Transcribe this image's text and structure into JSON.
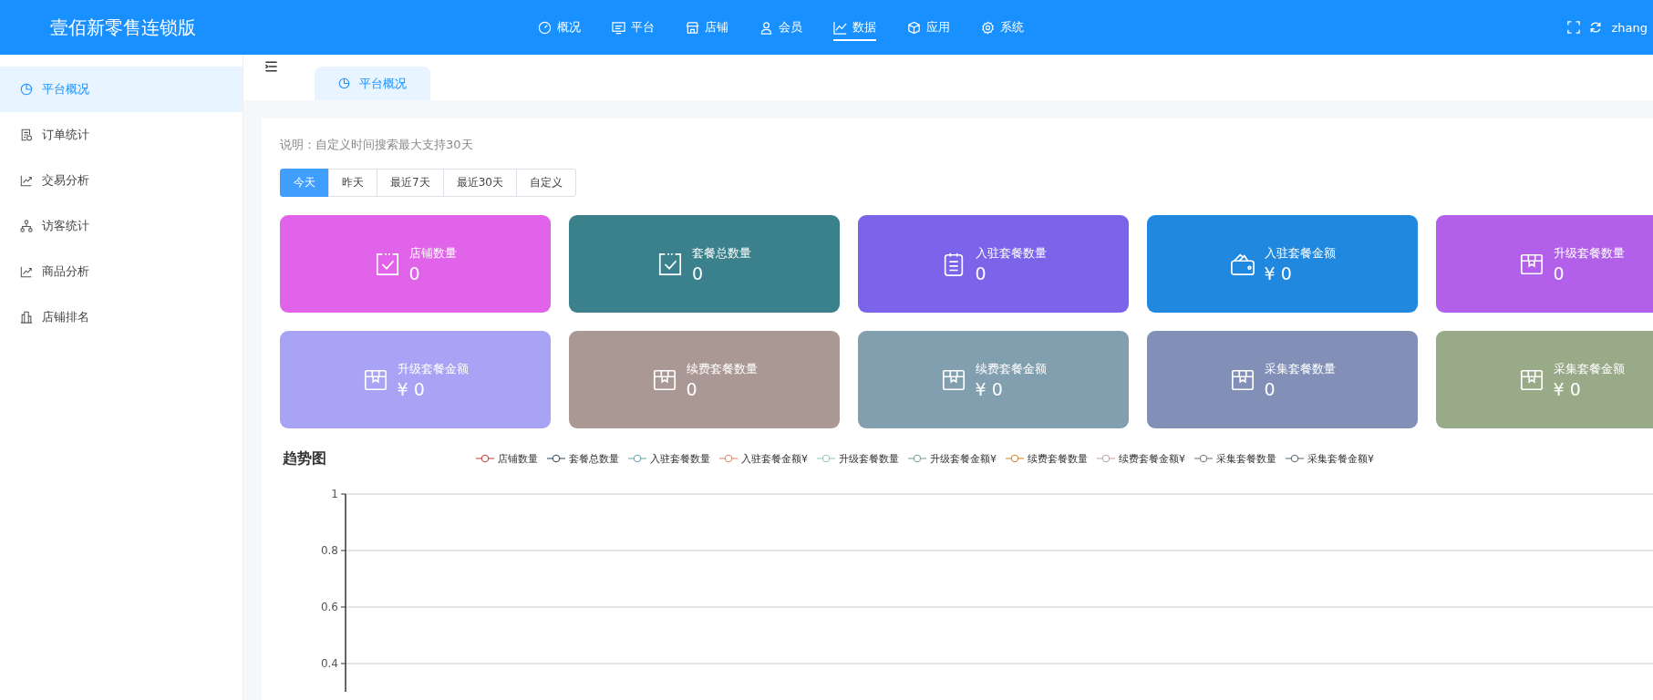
{
  "header": {
    "brand": "壹佰新零售连锁版",
    "nav": [
      {
        "label": "概况",
        "selected": false
      },
      {
        "label": "平台",
        "selected": false
      },
      {
        "label": "店铺",
        "selected": false
      },
      {
        "label": "会员",
        "selected": false
      },
      {
        "label": "数据",
        "selected": true
      },
      {
        "label": "应用",
        "selected": false
      },
      {
        "label": "系统",
        "selected": false
      }
    ],
    "user": "zhang"
  },
  "sidebar": {
    "items": [
      {
        "label": "平台概况",
        "selected": true
      },
      {
        "label": "订单统计",
        "selected": false
      },
      {
        "label": "交易分析",
        "selected": false
      },
      {
        "label": "访客统计",
        "selected": false
      },
      {
        "label": "商品分析",
        "selected": false
      },
      {
        "label": "店铺排名",
        "selected": false
      }
    ]
  },
  "tabs": [
    {
      "label": "平台概况",
      "selected": true
    }
  ],
  "note": "说明：自定义时间搜索最大支持30天",
  "ranges": [
    {
      "label": "今天",
      "selected": true
    },
    {
      "label": "昨天",
      "selected": false
    },
    {
      "label": "最近7天",
      "selected": false
    },
    {
      "label": "最近30天",
      "selected": false
    },
    {
      "label": "自定义",
      "selected": false
    }
  ],
  "cards": [
    {
      "kind": "check",
      "label": "店铺数量",
      "value": "0",
      "color": "#e063ea"
    },
    {
      "kind": "check",
      "label": "套餐总数量",
      "value": "0",
      "color": "#3a818c"
    },
    {
      "kind": "clipboard",
      "label": "入驻套餐数量",
      "value": "0",
      "color": "#7b63ea"
    },
    {
      "kind": "wallet",
      "label": "入驻套餐金额",
      "value": "¥ 0",
      "color": "#2188e0"
    },
    {
      "kind": "box",
      "label": "升级套餐数量",
      "value": "0",
      "color": "#b260ea"
    },
    {
      "kind": "box",
      "label": "升级套餐金额",
      "value": "¥ 0",
      "color": "#a9a3f5"
    },
    {
      "kind": "box",
      "label": "续费套餐数量",
      "value": "0",
      "color": "#aa9895"
    },
    {
      "kind": "box",
      "label": "续费套餐金额",
      "value": "¥ 0",
      "color": "#829fb0"
    },
    {
      "kind": "box",
      "label": "采集套餐数量",
      "value": "0",
      "color": "#8290b8"
    },
    {
      "kind": "box",
      "label": "采集套餐金额",
      "value": "¥ 0",
      "color": "#98aa88"
    }
  ],
  "trend": {
    "title": "趋势图",
    "chart_data": {
      "type": "line",
      "grid": true,
      "ylim": [
        0.3,
        1
      ],
      "yticks": [
        0.4,
        0.6,
        0.8,
        1
      ],
      "series": [
        {
          "name": "店铺数量",
          "color": "#c23531"
        },
        {
          "name": "套餐总数量",
          "color": "#2f4554"
        },
        {
          "name": "入驻套餐数量",
          "color": "#61a0a8"
        },
        {
          "name": "入驻套餐金额¥",
          "color": "#d48265"
        },
        {
          "name": "升级套餐数量",
          "color": "#91c7ae"
        },
        {
          "name": "升级套餐金额¥",
          "color": "#749f83"
        },
        {
          "name": "续费套餐数量",
          "color": "#ca8622"
        },
        {
          "name": "续费套餐金额¥",
          "color": "#bda29a"
        },
        {
          "name": "采集套餐数量",
          "color": "#6e7074"
        },
        {
          "name": "采集套餐金额¥",
          "color": "#546570"
        }
      ]
    }
  }
}
